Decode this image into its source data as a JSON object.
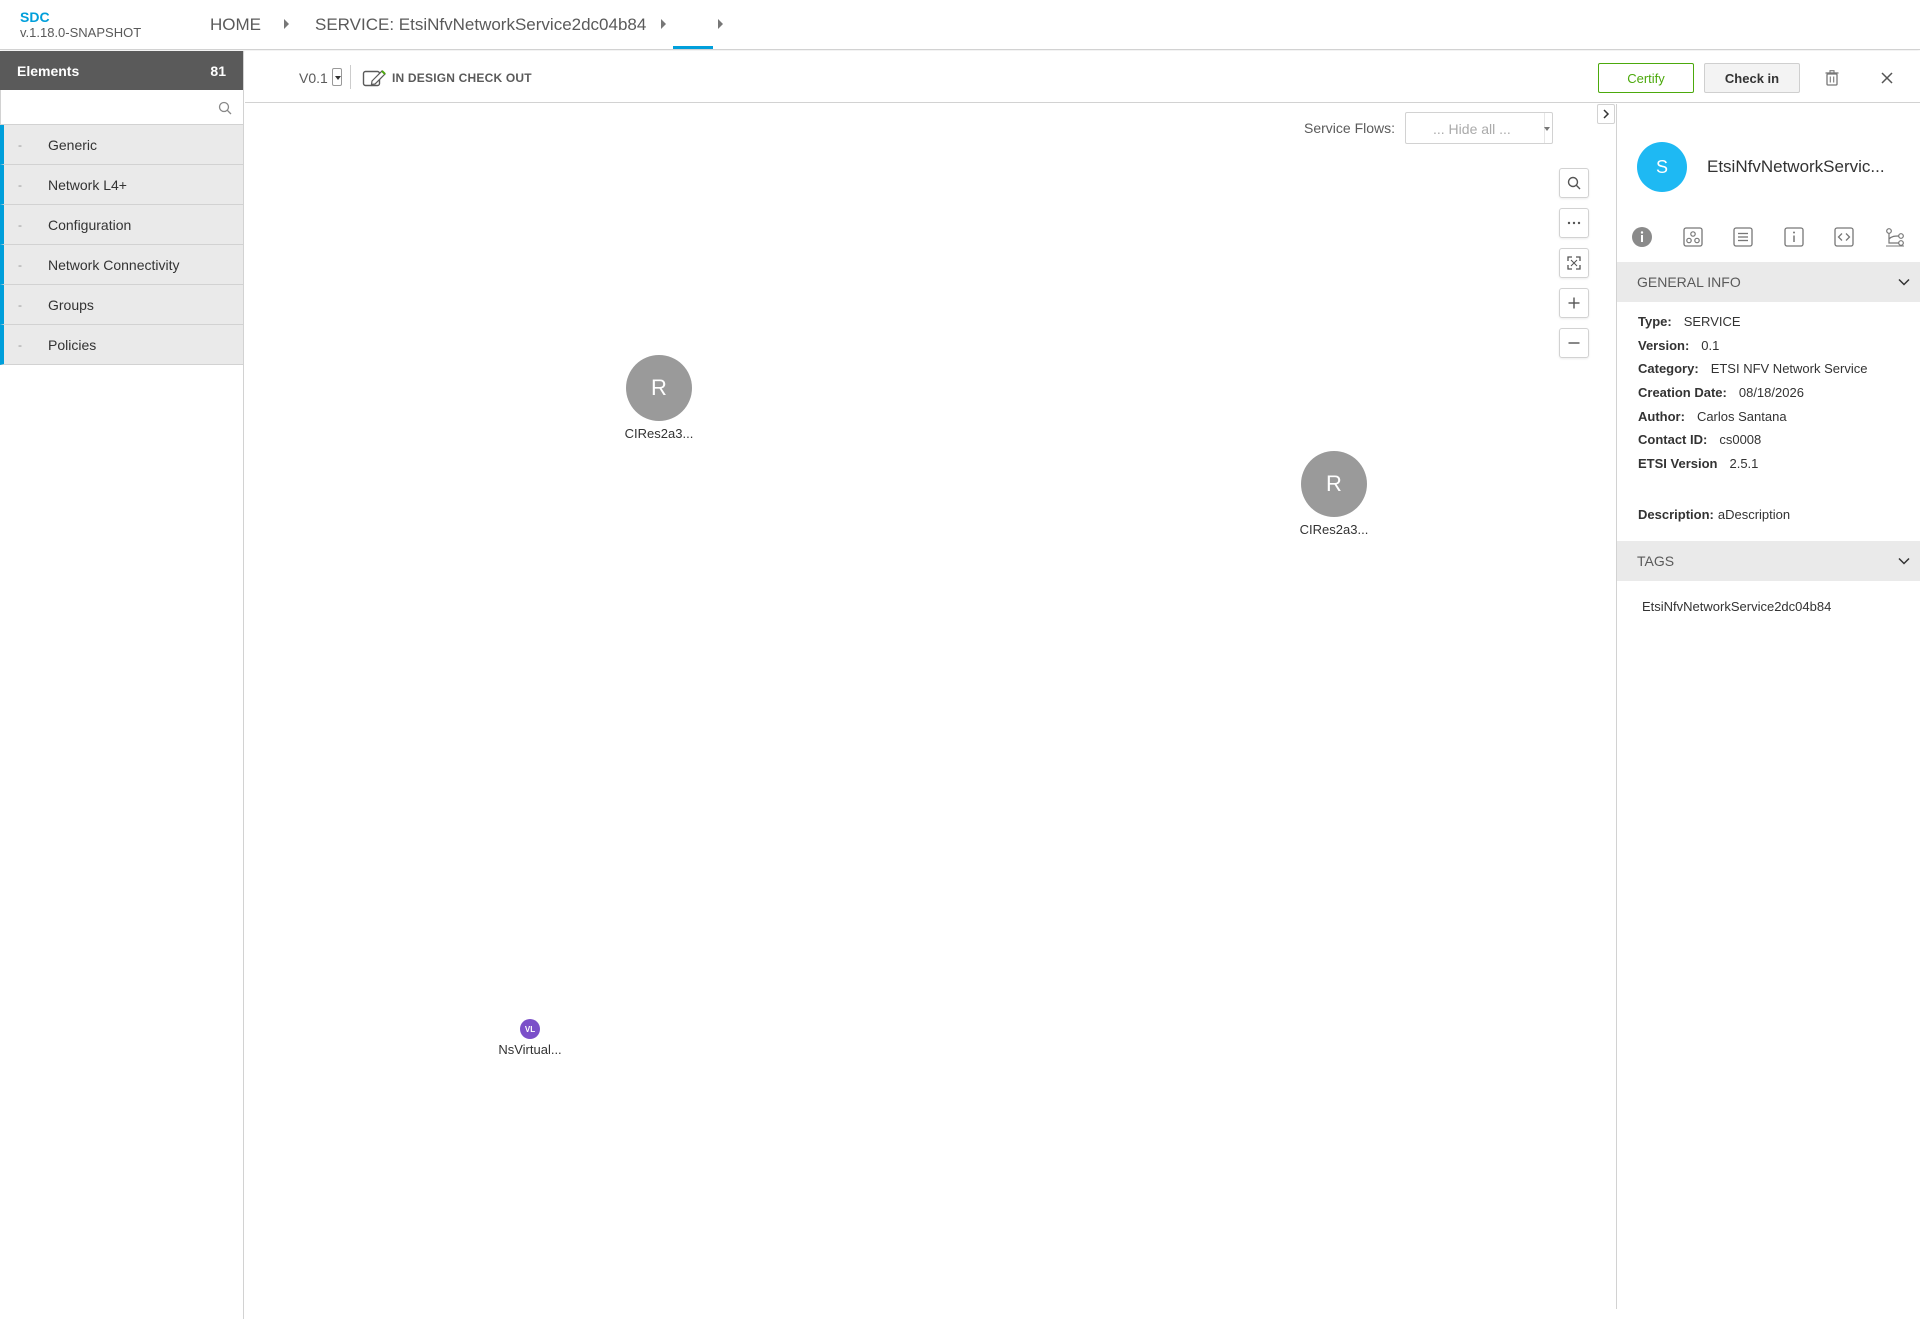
{
  "header": {
    "app_name": "SDC",
    "app_version": "v.1.18.0-SNAPSHOT",
    "breadcrumbs": [
      "HOME",
      "SERVICE: EtsiNfvNetworkService2dc04b84",
      ""
    ]
  },
  "palette": {
    "title": "Elements",
    "count": "81",
    "search_placeholder": "",
    "categories": [
      {
        "label": "Generic"
      },
      {
        "label": "Network L4+"
      },
      {
        "label": "Configuration"
      },
      {
        "label": "Network Connectivity"
      },
      {
        "label": "Groups"
      },
      {
        "label": "Policies"
      }
    ]
  },
  "toolbar": {
    "version": "V0.1",
    "status": "IN DESIGN CHECK OUT",
    "certify_label": "Certify",
    "checkin_label": "Check in"
  },
  "canvas": {
    "service_flows_label": "Service Flows:",
    "service_flows_value": "... Hide all ...",
    "nodes": [
      {
        "badge": "R",
        "label": "CIRes2a3..."
      },
      {
        "badge": "R",
        "label": "CIRes2a3..."
      },
      {
        "badge": "VL",
        "label": "NsVirtual..."
      }
    ],
    "zoom_controls": [
      "search-icon",
      "more-icon",
      "fit-icon",
      "zoom-in-icon",
      "zoom-out-icon"
    ]
  },
  "right_panel": {
    "avatar_letter": "S",
    "title": "EtsiNfvNetworkServic...",
    "tabs": [
      "info-tab",
      "composition-tab",
      "artifacts-tab",
      "properties-tab",
      "api-tab",
      "flows-tab"
    ],
    "general_info_title": "GENERAL INFO",
    "info": {
      "type": {
        "k": "Type:",
        "v": "SERVICE"
      },
      "version": {
        "k": "Version:",
        "v": "0.1"
      },
      "category": {
        "k": "Category:",
        "v": "ETSI NFV Network Service"
      },
      "creation_date": {
        "k": "Creation Date:",
        "v": "08/18/2026"
      },
      "author": {
        "k": "Author:",
        "v": "Carlos Santana"
      },
      "contact_id": {
        "k": "Contact ID:",
        "v": "cs0008"
      },
      "etsi_version": {
        "k": "ETSI Version",
        "v": "2.5.1"
      },
      "description": {
        "k": "Description:",
        "v": "aDescription"
      }
    },
    "tags_title": "TAGS",
    "tags": [
      "EtsiNfvNetworkService2dc04b84"
    ]
  },
  "colors": {
    "accent": "#009fdb",
    "certify": "#4ca90c",
    "palette_header": "#5a5a5a",
    "avatar": "#1eb9f3",
    "node_gray": "#9a9a9a",
    "vl_purple": "#7b4fc9"
  }
}
